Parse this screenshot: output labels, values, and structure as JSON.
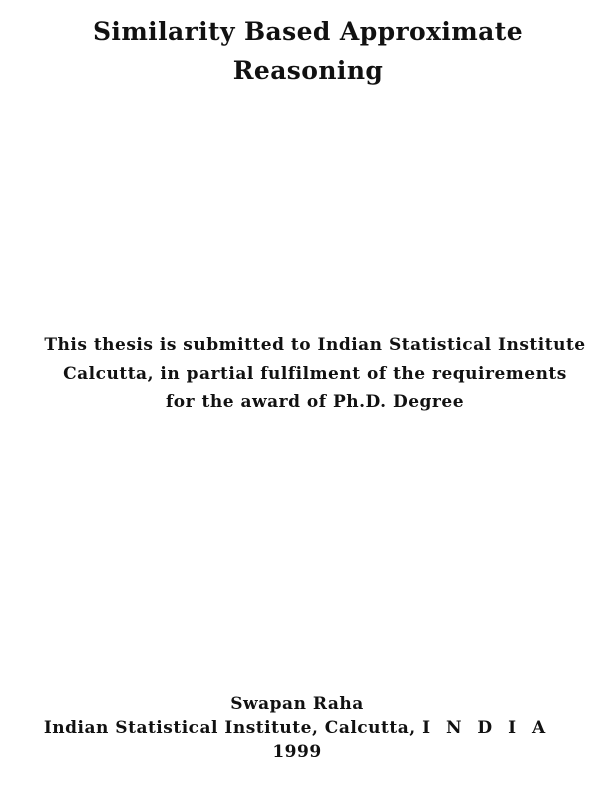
{
  "title": {
    "line1": "Similarity Based Approximate",
    "line2": "Reasoning"
  },
  "submission": {
    "line1": "This thesis is submitted to Indian Statistical Institute",
    "line2": "Calcutta, in partial fulfilment of the requirements",
    "line3": "for the award of Ph.D. Degree"
  },
  "author": {
    "name": "Swapan Raha",
    "affiliation": "Indian Statistical Institute, Calcutta,",
    "country": "I N D I A",
    "year": "1999"
  }
}
